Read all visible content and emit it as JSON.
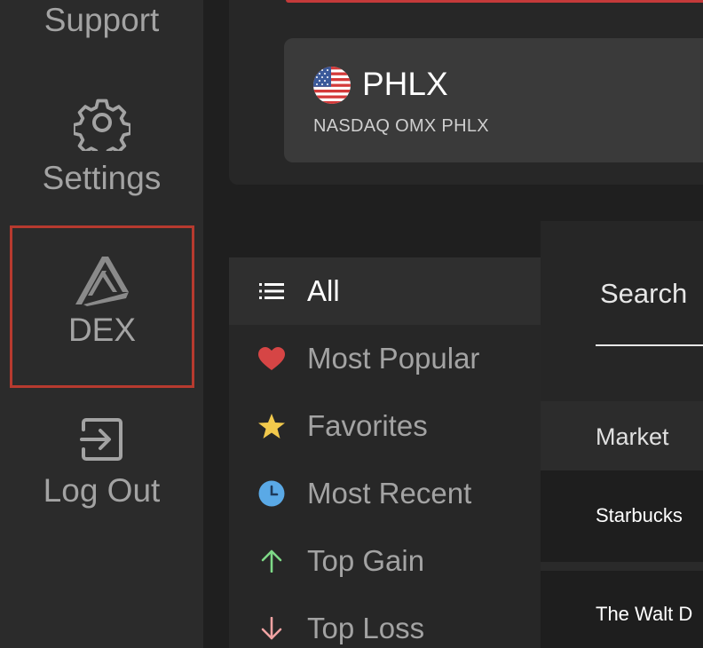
{
  "sidebar": {
    "items": [
      {
        "label": "Support",
        "icon": "support-icon"
      },
      {
        "label": "Settings",
        "icon": "gear-icon"
      },
      {
        "label": "DEX",
        "icon": "dex-logo-icon",
        "highlight_color": "#b73a2f"
      },
      {
        "label": "Log Out",
        "icon": "logout-icon"
      }
    ]
  },
  "exchange": {
    "code": "PHLX",
    "name": "NASDAQ OMX PHLX",
    "flag_icon": "us-flag-icon",
    "accent_color": "#c43a3a"
  },
  "filters": {
    "items": [
      {
        "label": "All",
        "icon": "list-icon"
      },
      {
        "label": "Most Popular",
        "icon": "heart-icon",
        "color": "#d64545"
      },
      {
        "label": "Favorites",
        "icon": "star-icon",
        "color": "#f2c94c"
      },
      {
        "label": "Most Recent",
        "icon": "clock-icon",
        "color": "#5aa9e6"
      },
      {
        "label": "Top Gain",
        "icon": "arrow-up-icon",
        "color": "#7ed987"
      },
      {
        "label": "Top Loss",
        "icon": "arrow-down-icon",
        "color": "#f0a3a3"
      }
    ],
    "active": "All"
  },
  "content": {
    "search_tab": "Search",
    "column_header": "Market",
    "rows": [
      "Starbucks",
      "The Walt D"
    ]
  }
}
